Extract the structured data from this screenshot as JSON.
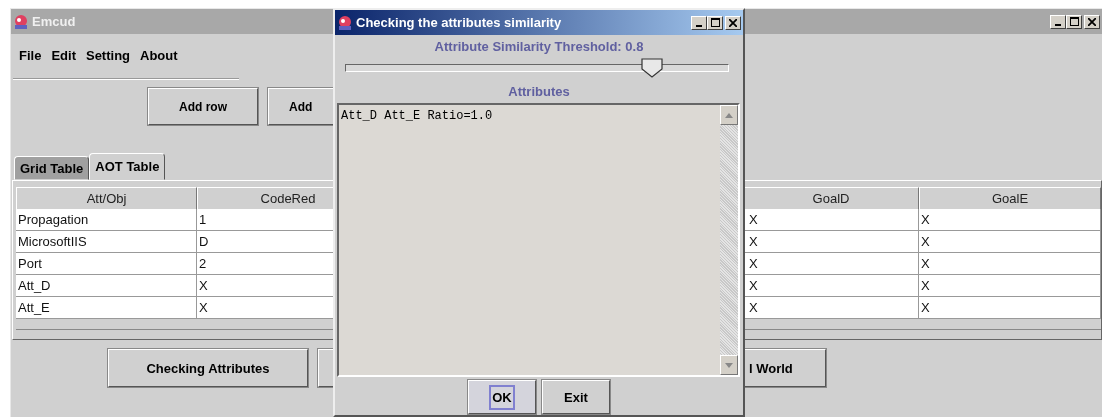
{
  "main_window": {
    "title": "Emcud"
  },
  "menu": [
    "File",
    "Edit",
    "Setting",
    "About"
  ],
  "toolbar_buttons": [
    {
      "label": "Add row"
    },
    {
      "label": "Add"
    }
  ],
  "tabs": [
    {
      "label": "Grid Table",
      "selected": false
    },
    {
      "label": "AOT Table",
      "selected": true
    }
  ],
  "table": {
    "columns": [
      "Att/Obj",
      "CodeRed",
      "GoalD",
      "GoalE"
    ],
    "rows": [
      [
        "Propagation",
        "1",
        "X",
        "X"
      ],
      [
        "MicrosoftIIS",
        "D",
        "X",
        "X"
      ],
      [
        "Port",
        "2",
        "X",
        "X"
      ],
      [
        "Att_D",
        "X",
        "X",
        "X"
      ],
      [
        "Att_E",
        "X",
        "X",
        "X"
      ]
    ]
  },
  "bottom_buttons": [
    {
      "label": "Checking Attributes"
    },
    {
      "label": "l World"
    }
  ],
  "dialog": {
    "title": "Checking the attributes similarity",
    "threshold_label": "Attribute Similarity Threshold: 0.8",
    "slider": {
      "level": 0.8
    },
    "attributes_label": "Attributes",
    "text_area": {
      "value": "Att_D Att_E Ratio=1.0"
    },
    "buttons": [
      {
        "label": "OK",
        "focused": true
      },
      {
        "label": "Exit",
        "focused": false
      }
    ]
  }
}
